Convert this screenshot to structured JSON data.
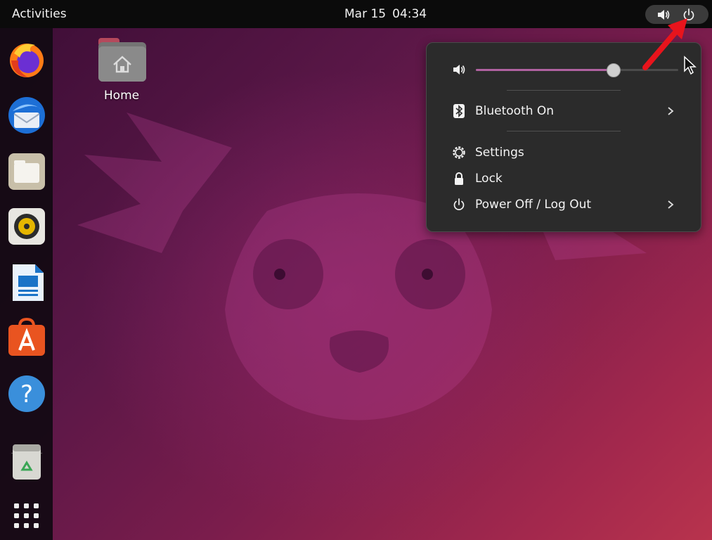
{
  "topbar": {
    "activities": "Activities",
    "date": "Mar 15",
    "time": "04:34",
    "status_icons": [
      "speaker-icon",
      "power-icon"
    ]
  },
  "desktop": {
    "home_label": "Home"
  },
  "dock": {
    "apps": [
      "firefox-icon",
      "thunderbird-icon",
      "files-icon",
      "rhythmbox-icon",
      "libreoffice-writer-icon",
      "ubuntu-software-icon",
      "help-icon",
      "trash-icon",
      "show-apps-icon"
    ]
  },
  "system_menu": {
    "volume_level": 0.68,
    "bluetooth_label": "Bluetooth On",
    "settings_label": "Settings",
    "lock_label": "Lock",
    "power_label": "Power Off / Log Out"
  },
  "colors": {
    "accent": "#b062a0",
    "annotation_arrow": "#e8141c",
    "topbar": "#0b0b0b",
    "menu_bg": "#2b2b2b"
  }
}
